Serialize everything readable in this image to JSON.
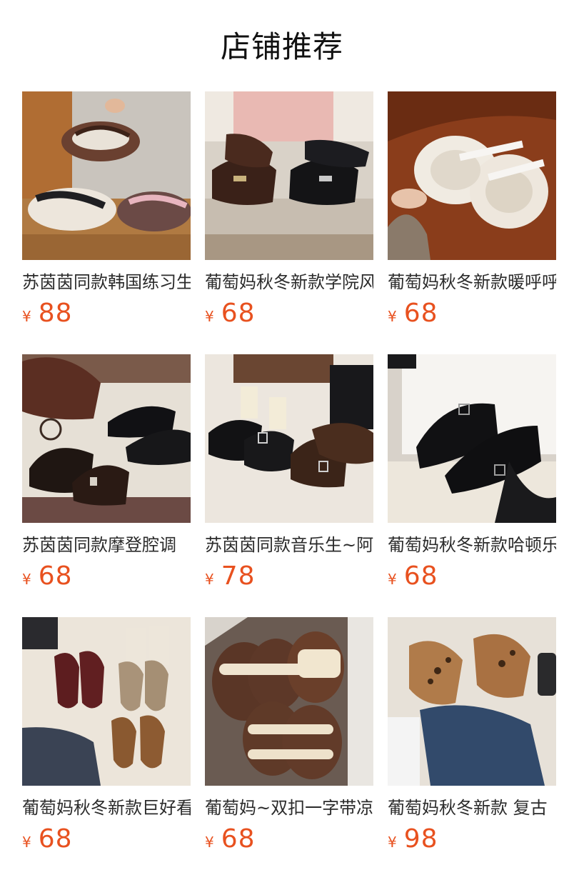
{
  "header": {
    "title": "店铺推荐"
  },
  "products": [
    {
      "name": "苏茵茵同款韩国练习生",
      "currency": "¥",
      "price": "88",
      "image": "brown-white-sneakers-photo"
    },
    {
      "name": "葡萄妈秋冬新款学院风",
      "currency": "¥",
      "price": "68",
      "image": "black-brown-loafers-photo"
    },
    {
      "name": "葡萄妈秋冬新款暖呼呼",
      "currency": "¥",
      "price": "68",
      "image": "fluffy-white-mary-jane-photo"
    },
    {
      "name": "苏茵茵同款摩登腔调",
      "currency": "¥",
      "price": "68",
      "image": "buckle-derby-shoes-photo"
    },
    {
      "name": "苏茵茵同款音乐生~阿",
      "currency": "¥",
      "price": "78",
      "image": "buckle-loafers-socks-photo"
    },
    {
      "name": "葡萄妈秋冬新款哈顿乐",
      "currency": "¥",
      "price": "68",
      "image": "monk-strap-shoes-photo"
    },
    {
      "name": "葡萄妈秋冬新款巨好看",
      "currency": "¥",
      "price": "68",
      "image": "suede-loafers-photo"
    },
    {
      "name": "葡萄妈~双扣一字带凉",
      "currency": "¥",
      "price": "68",
      "image": "fur-slides-photo"
    },
    {
      "name": "葡萄妈秋冬新款 复古",
      "currency": "¥",
      "price": "98",
      "image": "leopard-moccasins-photo"
    }
  ]
}
